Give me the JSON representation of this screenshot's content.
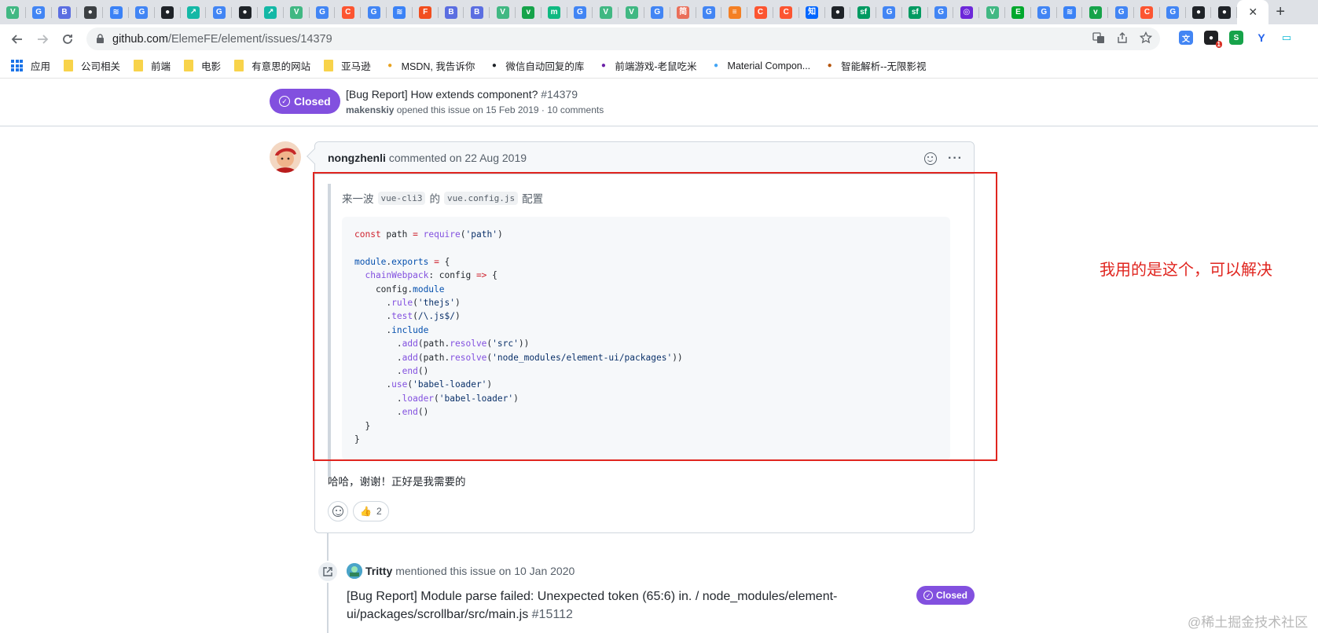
{
  "tabs": {
    "favicons": [
      {
        "icon": "vue-icon",
        "glyph": "V",
        "color": "#41b883"
      },
      {
        "icon": "google-icon",
        "glyph": "G",
        "color": "#4285f4"
      },
      {
        "icon": "bot-icon",
        "glyph": "B",
        "color": "#5b6ee1"
      },
      {
        "icon": "globe-icon",
        "glyph": "●",
        "color": "#3c4043"
      },
      {
        "icon": "layers-icon",
        "glyph": "≋",
        "color": "#3b82f6"
      },
      {
        "icon": "google-icon",
        "glyph": "G",
        "color": "#4285f4"
      },
      {
        "icon": "github-icon",
        "glyph": "●",
        "color": "#1f2328"
      },
      {
        "icon": "chart-icon",
        "glyph": "↗",
        "color": "#14b8a6"
      },
      {
        "icon": "google-icon",
        "glyph": "G",
        "color": "#4285f4"
      },
      {
        "icon": "github-icon",
        "glyph": "●",
        "color": "#1f2328"
      },
      {
        "icon": "chart-icon",
        "glyph": "↗",
        "color": "#14b8a6"
      },
      {
        "icon": "vue-icon",
        "glyph": "V",
        "color": "#41b883"
      },
      {
        "icon": "google-icon",
        "glyph": "G",
        "color": "#4285f4"
      },
      {
        "icon": "csdn-icon",
        "glyph": "C",
        "color": "#fc5531"
      },
      {
        "icon": "google-icon",
        "glyph": "G",
        "color": "#4285f4"
      },
      {
        "icon": "layers-icon",
        "glyph": "≋",
        "color": "#3b82f6"
      },
      {
        "icon": "figma-icon",
        "glyph": "F",
        "color": "#f24e1e"
      },
      {
        "icon": "bot-icon",
        "glyph": "B",
        "color": "#5b6ee1"
      },
      {
        "icon": "bot-icon",
        "glyph": "B",
        "color": "#5b6ee1"
      },
      {
        "icon": "vue-icon",
        "glyph": "V",
        "color": "#41b883"
      },
      {
        "icon": "vite-icon",
        "glyph": "v",
        "color": "#16a34a"
      },
      {
        "icon": "m-icon",
        "glyph": "m",
        "color": "#10b981"
      },
      {
        "icon": "google-icon",
        "glyph": "G",
        "color": "#4285f4"
      },
      {
        "icon": "vue-icon",
        "glyph": "V",
        "color": "#41b883"
      },
      {
        "icon": "vue-icon",
        "glyph": "V",
        "color": "#41b883"
      },
      {
        "icon": "google-icon",
        "glyph": "G",
        "color": "#4285f4"
      },
      {
        "icon": "jian-icon",
        "glyph": "简",
        "color": "#ea6f5a"
      },
      {
        "icon": "google-icon",
        "glyph": "G",
        "color": "#4285f4"
      },
      {
        "icon": "stack-icon",
        "glyph": "≡",
        "color": "#f48024"
      },
      {
        "icon": "csdn-icon",
        "glyph": "C",
        "color": "#fc5531"
      },
      {
        "icon": "csdn-icon",
        "glyph": "C",
        "color": "#fc5531"
      },
      {
        "icon": "zhihu-icon",
        "glyph": "知",
        "color": "#0066ff"
      },
      {
        "icon": "github-icon",
        "glyph": "●",
        "color": "#1f2328"
      },
      {
        "icon": "segmentfault-icon",
        "glyph": "sf",
        "color": "#009a61"
      },
      {
        "icon": "google-icon",
        "glyph": "G",
        "color": "#4285f4"
      },
      {
        "icon": "segmentfault-icon",
        "glyph": "sf",
        "color": "#009a61"
      },
      {
        "icon": "google-icon",
        "glyph": "G",
        "color": "#4285f4"
      },
      {
        "icon": "circle-icon",
        "glyph": "◎",
        "color": "#6d28d9"
      },
      {
        "icon": "vue-icon",
        "glyph": "V",
        "color": "#41b883"
      },
      {
        "icon": "evernote-icon",
        "glyph": "E",
        "color": "#00a82d"
      },
      {
        "icon": "google-icon",
        "glyph": "G",
        "color": "#4285f4"
      },
      {
        "icon": "layers-icon",
        "glyph": "≋",
        "color": "#3b82f6"
      },
      {
        "icon": "vite-icon",
        "glyph": "v",
        "color": "#16a34a"
      },
      {
        "icon": "google-icon",
        "glyph": "G",
        "color": "#4285f4"
      },
      {
        "icon": "csdn-icon",
        "glyph": "C",
        "color": "#fc5531"
      },
      {
        "icon": "google-icon",
        "glyph": "G",
        "color": "#4285f4"
      },
      {
        "icon": "github-icon",
        "glyph": "●",
        "color": "#1f2328"
      },
      {
        "icon": "github-icon",
        "glyph": "●",
        "color": "#1f2328"
      }
    ],
    "close_glyph": "✕",
    "new_tab_glyph": "+"
  },
  "toolbar": {
    "url_host": "github.com",
    "url_path": "/ElemeFE/element/issues/14379",
    "badge_count": "1"
  },
  "bookmarks": [
    {
      "type": "apps",
      "label": "应用"
    },
    {
      "type": "folder",
      "label": "公司相关"
    },
    {
      "type": "folder",
      "label": "前端"
    },
    {
      "type": "folder",
      "label": "电影"
    },
    {
      "type": "folder",
      "label": "有意思的网站"
    },
    {
      "type": "folder",
      "label": "亚马逊"
    },
    {
      "type": "site",
      "label": "MSDN, 我告诉你",
      "icon": "msdn-icon",
      "color": "#e8a21f"
    },
    {
      "type": "site",
      "label": "微信自动回复的库",
      "icon": "github-icon",
      "color": "#1f2328"
    },
    {
      "type": "site",
      "label": "前端游戏-老鼠吃米",
      "icon": "game-icon",
      "color": "#6b21a8"
    },
    {
      "type": "site",
      "label": "Material Compon...",
      "icon": "flutter-icon",
      "color": "#42a5f5"
    },
    {
      "type": "site",
      "label": "智能解析--无限影视",
      "icon": "mm-icon",
      "color": "#b45309"
    }
  ],
  "issue_header": {
    "state": "Closed",
    "title": "[Bug Report] How extends component?",
    "number": "#14379",
    "author": "makenskiy",
    "meta": "opened this issue on 15 Feb 2019 · 10 comments"
  },
  "comment": {
    "author": "nongzhenli",
    "date": "commented on 22 Aug 2019",
    "quote_prefix": "来一波",
    "quote_code1": "vue-cli3",
    "quote_mid": "的",
    "quote_code2": "vue.config.js",
    "quote_suffix": "配置",
    "reply": "哈哈，谢谢！正好是我需要的",
    "reaction_emoji": "👍",
    "reaction_count": "2"
  },
  "annotation": "我用的是这个，可以解决",
  "timeline": {
    "author": "Tritty",
    "action": "mentioned this issue on 10 Jan 2020",
    "title": "[Bug Report] Module parse failed: Unexpected token (65:6) in. / node_modules/element-ui/packages/scrollbar/src/main.js",
    "number": "#15112",
    "state": "Closed"
  },
  "watermark": "@稀土掘金技术社区",
  "colors": {
    "closed_purple": "#8250df",
    "annotation_red": "#e0251f"
  }
}
